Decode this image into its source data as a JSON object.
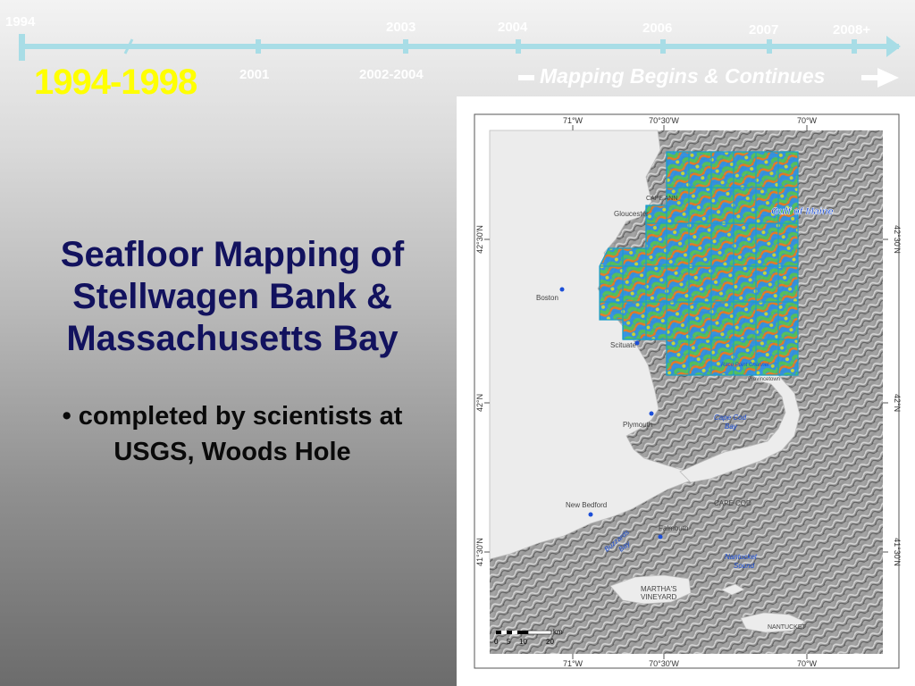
{
  "timeline": {
    "years": [
      "1994",
      "2003",
      "2004",
      "2006",
      "2007",
      "2008+"
    ],
    "sub_years": [
      "2001",
      "2002-2004"
    ],
    "era": "1994-1998",
    "mapping_label": "Mapping Begins & Continues",
    "line_color": "#a8dde6"
  },
  "title": {
    "lines": [
      "Seafloor Mapping of",
      "Stellwagen Bank &",
      "Massachusetts Bay"
    ],
    "bullet_lines": [
      "• completed by scientists at",
      "USGS, Woods Hole"
    ]
  },
  "map": {
    "top_lon": [
      "71°W",
      "70°30'W",
      "70°W"
    ],
    "bottom_lon": [
      "71°W",
      "70°30'W",
      "70°W"
    ],
    "lat": [
      "42°30'N",
      "42°N",
      "41°30'N"
    ],
    "places": {
      "gloucester": "Gloucester",
      "cape_ann": "CAPE ANN",
      "boston": "Boston",
      "scituate": "Scituate",
      "plymouth": "Plymouth",
      "new_bedford": "New Bedford",
      "falmouth": "Falmouth",
      "cape_cod": "CAPE COD",
      "marthas_1": "MARTHA'S",
      "marthas_2": "VINEYARD",
      "nantucket": "NANTUCKET",
      "provincetown": "Provincetown"
    },
    "water": {
      "gulf_of_maine": "Gulf of Maine",
      "cape_cod_bay_1": "Cape Cod",
      "cape_cod_bay_2": "Bay",
      "buzzards_1": "Buzzards",
      "buzzards_2": "Bay",
      "nantucket_sound_1": "Nantucket",
      "nantucket_sound_2": "Sound",
      "race_point": "Race Point Channel"
    },
    "scale": {
      "unit": "km",
      "ticks": [
        "0",
        "5",
        "10",
        "20"
      ]
    },
    "colors": {
      "survey_outline": "#1aa0c8",
      "label_blue": "#1c4fd8"
    }
  }
}
